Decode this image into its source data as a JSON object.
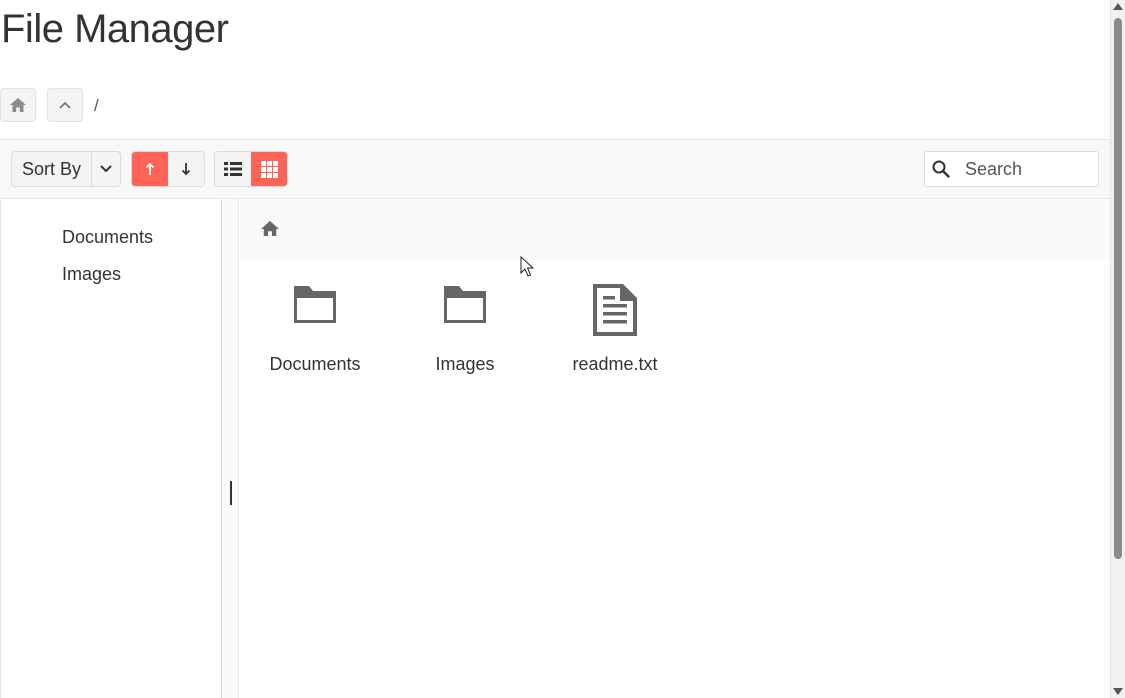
{
  "page": {
    "title": "File Manager"
  },
  "breadcrumb": {
    "path": "/"
  },
  "toolbar": {
    "sort_by_label": "Sort By",
    "search_placeholder": "Search"
  },
  "tree": {
    "items": [
      {
        "label": "Documents"
      },
      {
        "label": "Images"
      }
    ]
  },
  "content": {
    "items": [
      {
        "name": "Documents",
        "kind": "folder-icon"
      },
      {
        "name": "Images",
        "kind": "folder-icon"
      },
      {
        "name": "readme.txt",
        "kind": "text-file-icon"
      }
    ]
  },
  "colors": {
    "accent": "#ff6358",
    "icon": "#666666",
    "text": "#333333"
  }
}
